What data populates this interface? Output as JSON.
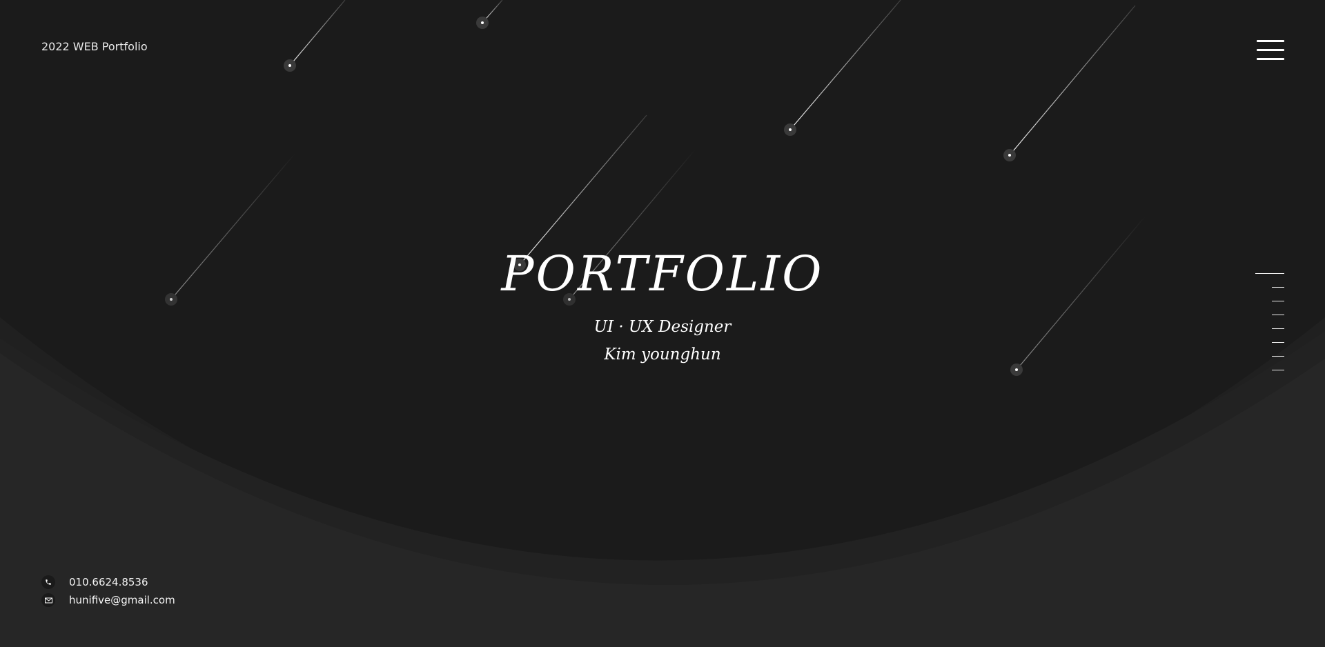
{
  "header": {
    "title": "2022 WEB Portfolio",
    "menu_icon": "hamburger-menu-icon"
  },
  "hero": {
    "title": "PORTFOLIO",
    "role": "UI · UX Designer",
    "name": "Kim younghun"
  },
  "side_nav": {
    "item_count": 8,
    "active_index": 0
  },
  "contact": {
    "phone_icon": "phone-icon",
    "phone": "010.6624.8536",
    "email_icon": "mail-icon",
    "email": "hunifive@gmail.com"
  },
  "colors": {
    "background": "#1b1b1b",
    "wave_light": "#262626",
    "wave_mid": "#222222",
    "text": "#ffffff"
  }
}
